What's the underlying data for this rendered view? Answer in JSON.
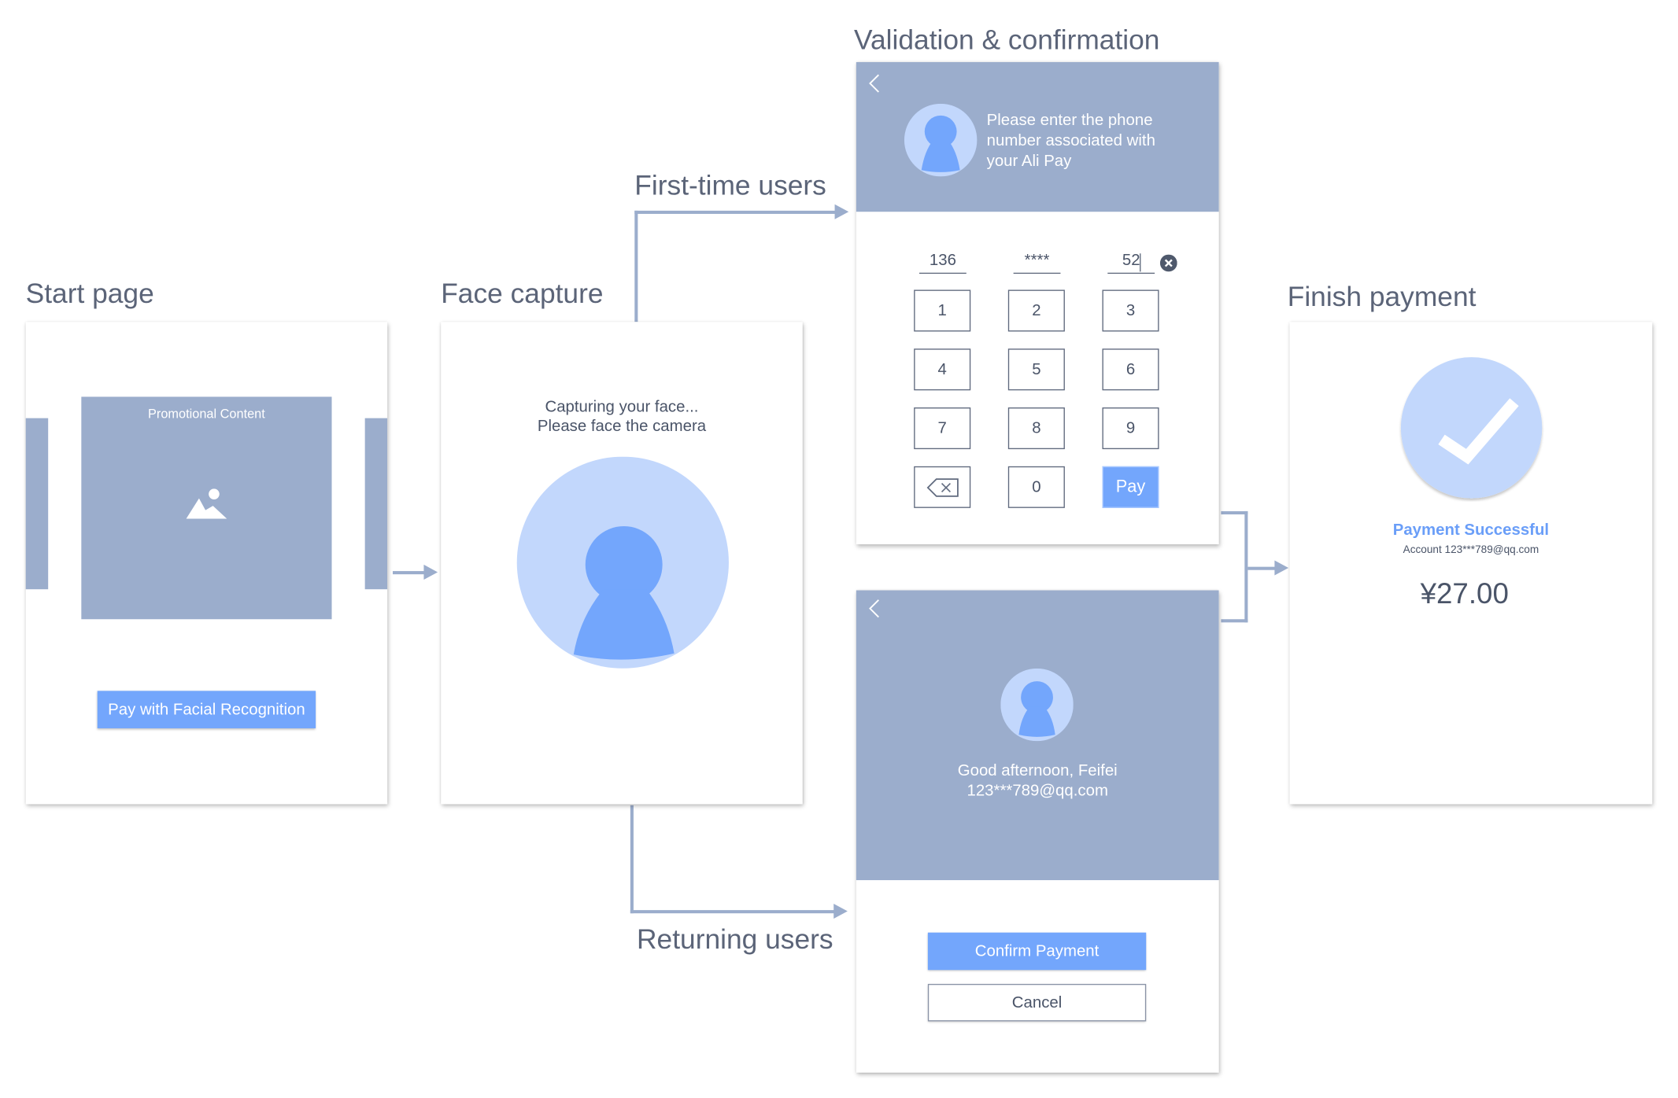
{
  "sections": {
    "start": "Start page",
    "face": "Face capture",
    "validation": "Validation & confirmation",
    "finish": "Finish payment"
  },
  "branches": {
    "first_time": "First-time users",
    "returning": "Returning users"
  },
  "start_page": {
    "promo_label": "Promotional Content",
    "promo_icon": "image-placeholder-icon",
    "pay_button": "Pay with Facial Recognition"
  },
  "face_capture": {
    "line1": "Capturing your face...",
    "line2": "Please face the camera",
    "icon": "user-silhouette-icon"
  },
  "phone_entry": {
    "back_icon": "chevron-left-icon",
    "prompt_line1": "Please enter the phone",
    "prompt_line2": "number associated with",
    "prompt_line3": "your Ali Pay",
    "fields": [
      "136",
      "****",
      "52"
    ],
    "clear_icon": "clear-circle-icon",
    "keys": [
      "1",
      "2",
      "3",
      "4",
      "5",
      "6",
      "7",
      "8",
      "9",
      "backspace",
      "0",
      "Pay"
    ],
    "backspace_icon": "backspace-icon"
  },
  "returning_confirm": {
    "back_icon": "chevron-left-icon",
    "greeting": "Good afternoon, Feifei",
    "account": "123***789@qq.com",
    "confirm_button": "Confirm Payment",
    "cancel_button": "Cancel"
  },
  "finish": {
    "status_icon": "checkmark-icon",
    "status": "Payment Successful",
    "account_line": "Account 123***789@qq.com",
    "amount": "¥27.00"
  },
  "colors": {
    "slate": "#9badcc",
    "accent_blue": "#73a6fc",
    "light_blue": "#c2d7fc",
    "text_dark": "#4a5468",
    "label_gray": "#5b6478"
  }
}
